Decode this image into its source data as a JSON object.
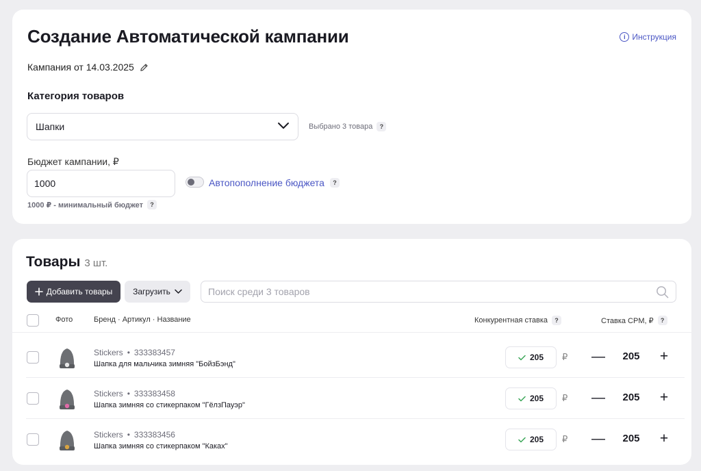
{
  "header": {
    "title": "Создание Автоматической кампании",
    "help_link": "Инструкция",
    "campaign_name": "Кампания от 14.03.2025"
  },
  "category": {
    "label": "Категория товаров",
    "selected": "Шапки",
    "selected_info": "Выбрано 3 товара"
  },
  "budget": {
    "label": "Бюджет кампании, ₽",
    "value": "1000",
    "auto_replenish": "Автопополнение бюджета",
    "auto_replenish_enabled": false,
    "min_hint": "1000 ₽ - минимальный бюджет"
  },
  "goods": {
    "title": "Товары",
    "count": "3 шт.",
    "add_button": "Добавить товары",
    "load_button": "Загрузить",
    "search_placeholder": "Поиск среди 3 товаров",
    "columns": {
      "photo": "Фото",
      "brand": "Бренд · Артикул · Название",
      "competitive_bid": "Конкурентная ставка",
      "cpm_bid": "Ставка CPM, ₽"
    },
    "currency": "₽",
    "rows": [
      {
        "brand": "Stickers",
        "article": "333383457",
        "name": "Шапка для мальчика зимняя \"БойзБэнд\"",
        "competitive_bid": "205",
        "cpm": "205",
        "sticker_color": "#e8e8e8"
      },
      {
        "brand": "Stickers",
        "article": "333383458",
        "name": "Шапка зимняя со стикерпаком \"ГёлзПауэр\"",
        "competitive_bid": "205",
        "cpm": "205",
        "sticker_color": "#e06aa8"
      },
      {
        "brand": "Stickers",
        "article": "333383456",
        "name": "Шапка зимняя со стикерпаком \"Каках\"",
        "competitive_bid": "205",
        "cpm": "205",
        "sticker_color": "#d9a441"
      }
    ]
  },
  "colors": {
    "accent": "#4a56c4",
    "primary_button": "#44434f",
    "background": "#eeeef1",
    "success_check": "#3aa657"
  }
}
